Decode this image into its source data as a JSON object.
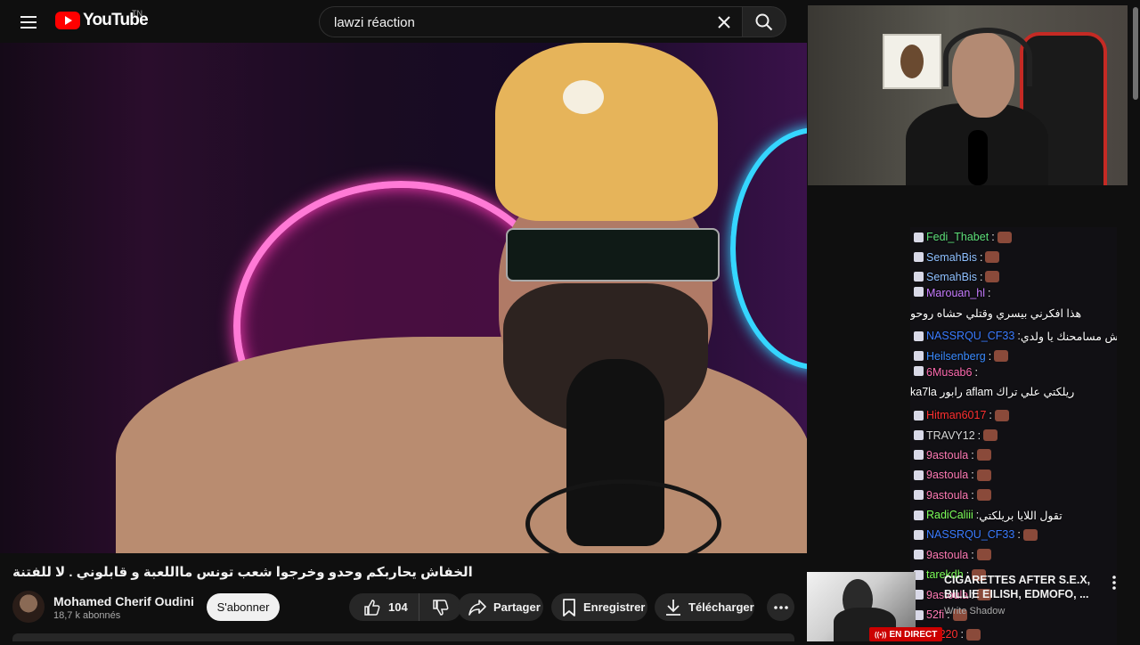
{
  "header": {
    "logo_text": "YouTube",
    "country_code": "TN",
    "search_value": "lawzi réaction"
  },
  "video": {
    "title": "الخفاش يحاربكم وحدو وخرجوا شعب تونس مااللعبة و قابلوني . لا للفتنة",
    "channel_name": "Mohamed Cherif Oudini",
    "subscribers": "18,7 k abonnés",
    "subscribe_label": "S'abonner",
    "like_count": "104",
    "share_label": "Partager",
    "save_label": "Enregistrer",
    "download_label": "Télécharger"
  },
  "chat": [
    {
      "user": "Fedi_Thabet",
      "color": "#5ee07a",
      "message": ""
    },
    {
      "user": "SemahBis",
      "color": "#8fc0ff",
      "message": ""
    },
    {
      "user": "SemahBis",
      "color": "#8fc0ff",
      "message": ""
    },
    {
      "user": "Marouan_hl",
      "color": "#c77cff",
      "message": "هذا افكرني بيسري وقتلي حشاه روحو"
    },
    {
      "user": "NASSRQU_CF33",
      "color": "#3a7bff",
      "message": "مناش مسامحنك يا ولدي"
    },
    {
      "user": "Heilsenberg",
      "color": "#3a8bff",
      "message": ""
    },
    {
      "user": "6Musab6",
      "color": "#ff6bb0",
      "message": "ريلكتي علي تراك aflam رابور ka7la"
    },
    {
      "user": "Hitman6017",
      "color": "#ff3030",
      "message": ""
    },
    {
      "user": "TRAVY12",
      "color": "#d8d8d8",
      "message": ""
    },
    {
      "user": "9astoula",
      "color": "#ff7bb5",
      "message": ""
    },
    {
      "user": "9astoula",
      "color": "#ff7bb5",
      "message": ""
    },
    {
      "user": "9astoula",
      "color": "#ff7bb5",
      "message": ""
    },
    {
      "user": "RadiCaliii",
      "color": "#7dff5a",
      "message": "تقول اللايا بريلكتي"
    },
    {
      "user": "NASSRQU_CF33",
      "color": "#3a7bff",
      "message": ""
    },
    {
      "user": "9astoula",
      "color": "#ff7bb5",
      "message": ""
    },
    {
      "user": "tarekdh",
      "color": "#7dff5a",
      "message": ""
    },
    {
      "user": "9astoula",
      "color": "#ff7bb5",
      "message": ""
    },
    {
      "user": "52fi",
      "color": "#ff7bb5",
      "message": ""
    },
    {
      "user": "Mr220",
      "color": "#ff3030",
      "message": ""
    }
  ],
  "recommended": {
    "title": "CIGARETTES AFTER S.E.X, BILLIE EILISH, EDMOFO, ...",
    "channel": "Write Shadow",
    "live_label": "EN DIRECT"
  },
  "colors": {
    "accent": "#ff0000",
    "live": "#cc0000"
  }
}
